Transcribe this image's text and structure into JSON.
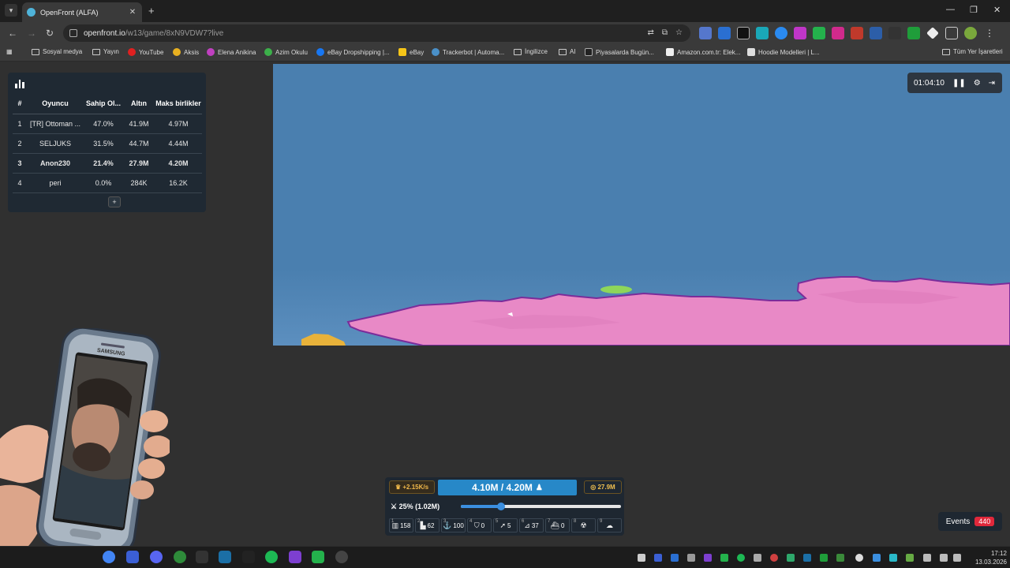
{
  "browser": {
    "tab_title": "OpenFront (ALFA)",
    "url_host": "openfront.io",
    "url_path": "/w13/game/8xN9VDW7?live",
    "bookmarks": [
      "Sosyal medya",
      "Yayın",
      "YouTube",
      "Aksis",
      "Elena Anikina",
      "Azim Okulu",
      "eBay Dropshipping |...",
      "eBay",
      "Trackerbot | Automa...",
      "İngilizce",
      "AI",
      "Piyasalarda Bugün...",
      "Amazon.com.tr: Elek...",
      "Hoodie Modelleri | L...",
      "Tüm Yer İşaretleri"
    ]
  },
  "leaderboard": {
    "headers": [
      "#",
      "Oyuncu",
      "Sahip Ol...",
      "Altın",
      "Maks birlikler"
    ],
    "rows": [
      [
        "1",
        "[TR] Ottoman ...",
        "47.0%",
        "41.9M",
        "4.97M"
      ],
      [
        "2",
        "SELJUKS",
        "31.5%",
        "44.7M",
        "4.44M"
      ],
      [
        "3",
        "Anon230",
        "21.4%",
        "27.9M",
        "4.20M"
      ],
      [
        "4",
        "peri",
        "0.0%",
        "284K",
        "16.2K"
      ]
    ],
    "highlight_row": 3,
    "expand_label": "+"
  },
  "game": {
    "timer": "01:04:10",
    "gold_rate": "+2.15K/s",
    "troops": "4.10M / 4.20M",
    "gold_total": "27.9M",
    "attack_ratio": "25% (1.02M)",
    "attack_ratio_value": 0.25,
    "buildings": [
      {
        "key": "1",
        "icon": "city-icon",
        "count": "158"
      },
      {
        "key": "2",
        "icon": "factory-icon",
        "count": "62"
      },
      {
        "key": "3",
        "icon": "port-icon",
        "count": "100"
      },
      {
        "key": "4",
        "icon": "defense-post-icon",
        "count": "0"
      },
      {
        "key": "5",
        "icon": "missile-silo-icon",
        "count": "5"
      },
      {
        "key": "6",
        "icon": "sam-launcher-icon",
        "count": "37"
      },
      {
        "key": "7",
        "icon": "warship-icon",
        "count": "0"
      },
      {
        "key": "8",
        "icon": "nuke-icon",
        "count": ""
      },
      {
        "key": "9",
        "icon": "hydrogen-bomb-icon",
        "count": ""
      }
    ],
    "events_label": "Events",
    "events_count": "440"
  },
  "webcam": {
    "phone_brand": "SAMSUNG"
  },
  "taskbar": {
    "time": "17:12",
    "date": "13.03.2026"
  },
  "colors": {
    "ocean": "#4a7faf",
    "player_pink": "#e889c6",
    "border_purple": "#7a2c9a",
    "troop_bar": "#2788c8",
    "events_badge": "#e0283b"
  }
}
